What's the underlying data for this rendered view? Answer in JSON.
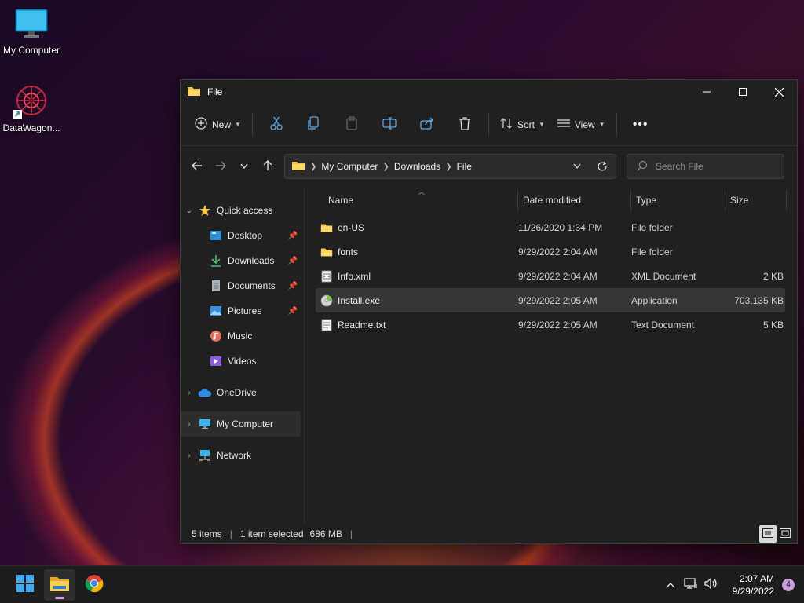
{
  "desktop": {
    "icons": [
      {
        "label": "My Computer"
      },
      {
        "label": "DataWagon..."
      }
    ]
  },
  "window": {
    "title": "File",
    "toolbar": {
      "new_label": "New",
      "sort_label": "Sort",
      "view_label": "View"
    },
    "address": {
      "crumbs": [
        "My Computer",
        "Downloads",
        "File"
      ]
    },
    "search": {
      "placeholder": "Search File"
    },
    "nav": {
      "quick_access": "Quick access",
      "items": [
        {
          "label": "Desktop"
        },
        {
          "label": "Downloads"
        },
        {
          "label": "Documents"
        },
        {
          "label": "Pictures"
        },
        {
          "label": "Music"
        },
        {
          "label": "Videos"
        }
      ],
      "onedrive": "OneDrive",
      "my_computer": "My Computer",
      "network": "Network"
    },
    "columns": {
      "name": "Name",
      "date": "Date modified",
      "type": "Type",
      "size": "Size"
    },
    "files": [
      {
        "name": "en-US",
        "date": "11/26/2020 1:34 PM",
        "type": "File folder",
        "size": "",
        "icon": "folder-icon"
      },
      {
        "name": "fonts",
        "date": "9/29/2022 2:04 AM",
        "type": "File folder",
        "size": "",
        "icon": "folder-icon"
      },
      {
        "name": "Info.xml",
        "date": "9/29/2022 2:04 AM",
        "type": "XML Document",
        "size": "2 KB",
        "icon": "xml-file-icon"
      },
      {
        "name": "Install.exe",
        "date": "9/29/2022 2:05 AM",
        "type": "Application",
        "size": "703,135 KB",
        "icon": "installer-disc-icon"
      },
      {
        "name": "Readme.txt",
        "date": "9/29/2022 2:05 AM",
        "type": "Text Document",
        "size": "5 KB",
        "icon": "text-file-icon"
      }
    ],
    "status": {
      "count": "5 items",
      "selected": "1 item selected",
      "size": "686 MB"
    }
  },
  "taskbar": {
    "time": "2:07 AM",
    "date": "9/29/2022",
    "notifications": "4"
  },
  "colors": {
    "accent": "#c89ed9",
    "folder": "#f4c14e"
  }
}
